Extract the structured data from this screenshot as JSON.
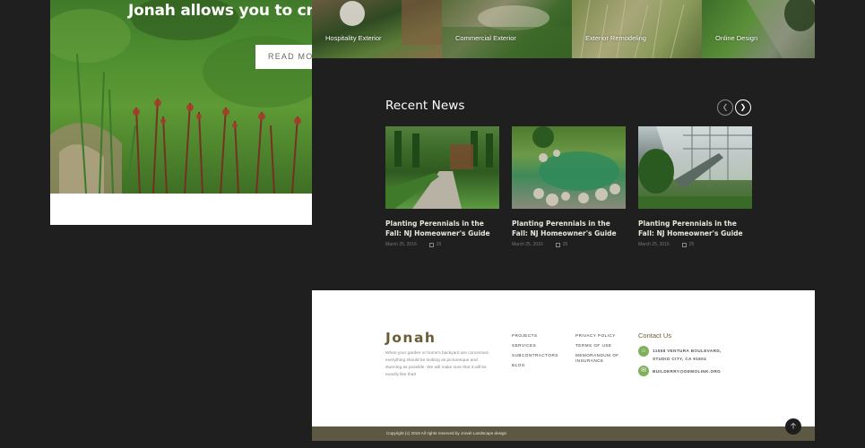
{
  "hero": {
    "title": "Jonah allows you to create",
    "button": "READ MORE"
  },
  "projects": [
    {
      "label": "Hospitality Exterior"
    },
    {
      "label": "Commercial Exterior"
    },
    {
      "label": "Exterior Remodeling"
    },
    {
      "label": "Online Design"
    }
  ],
  "news": {
    "title": "Recent News",
    "prev_icon": "chevron-left-icon",
    "next_icon": "chevron-right-icon",
    "items": [
      {
        "title": "Planting Perennials in the Fall: NJ Homeowner's Guide",
        "date": "March 25, 2016",
        "comments": "25"
      },
      {
        "title": "Planting Perennials in the Fall: NJ Homeowner's Guide",
        "date": "March 25, 2016",
        "comments": "25"
      },
      {
        "title": "Planting Perennials in the Fall: NJ Homeowner's Guide",
        "date": "March 25, 2016",
        "comments": "25"
      }
    ]
  },
  "footer": {
    "brand": "Jonah",
    "about": "When your garden or home's backyard are concerned, everything should be looking as picturesque and stunning as possible. We will make sure that it will be exactly like that!",
    "links_col1": [
      "PROJECTS",
      "SERVICES",
      "SUBCONTRACTORS",
      "BLOG"
    ],
    "links_col2": [
      "PRIVACY POLICY",
      "TERMS OF USE",
      "MEMORANDUM OF INSURANCE"
    ],
    "contact_title": "Contact Us",
    "address_line1": "11558 VENTURA BOULEVARD,",
    "address_line2": "STUDIO CITY, CA 91604",
    "email": "BUILDERRY@DEMOLINK.ORG",
    "copyright": "Copyright (c) 2016 All rights reserved by Jonah Landscape design"
  },
  "colors": {
    "page_bg": "#1f1f1f",
    "brand": "#6b5c34",
    "accent_green": "#7fb05a",
    "copy_bar": "#5c5843"
  }
}
